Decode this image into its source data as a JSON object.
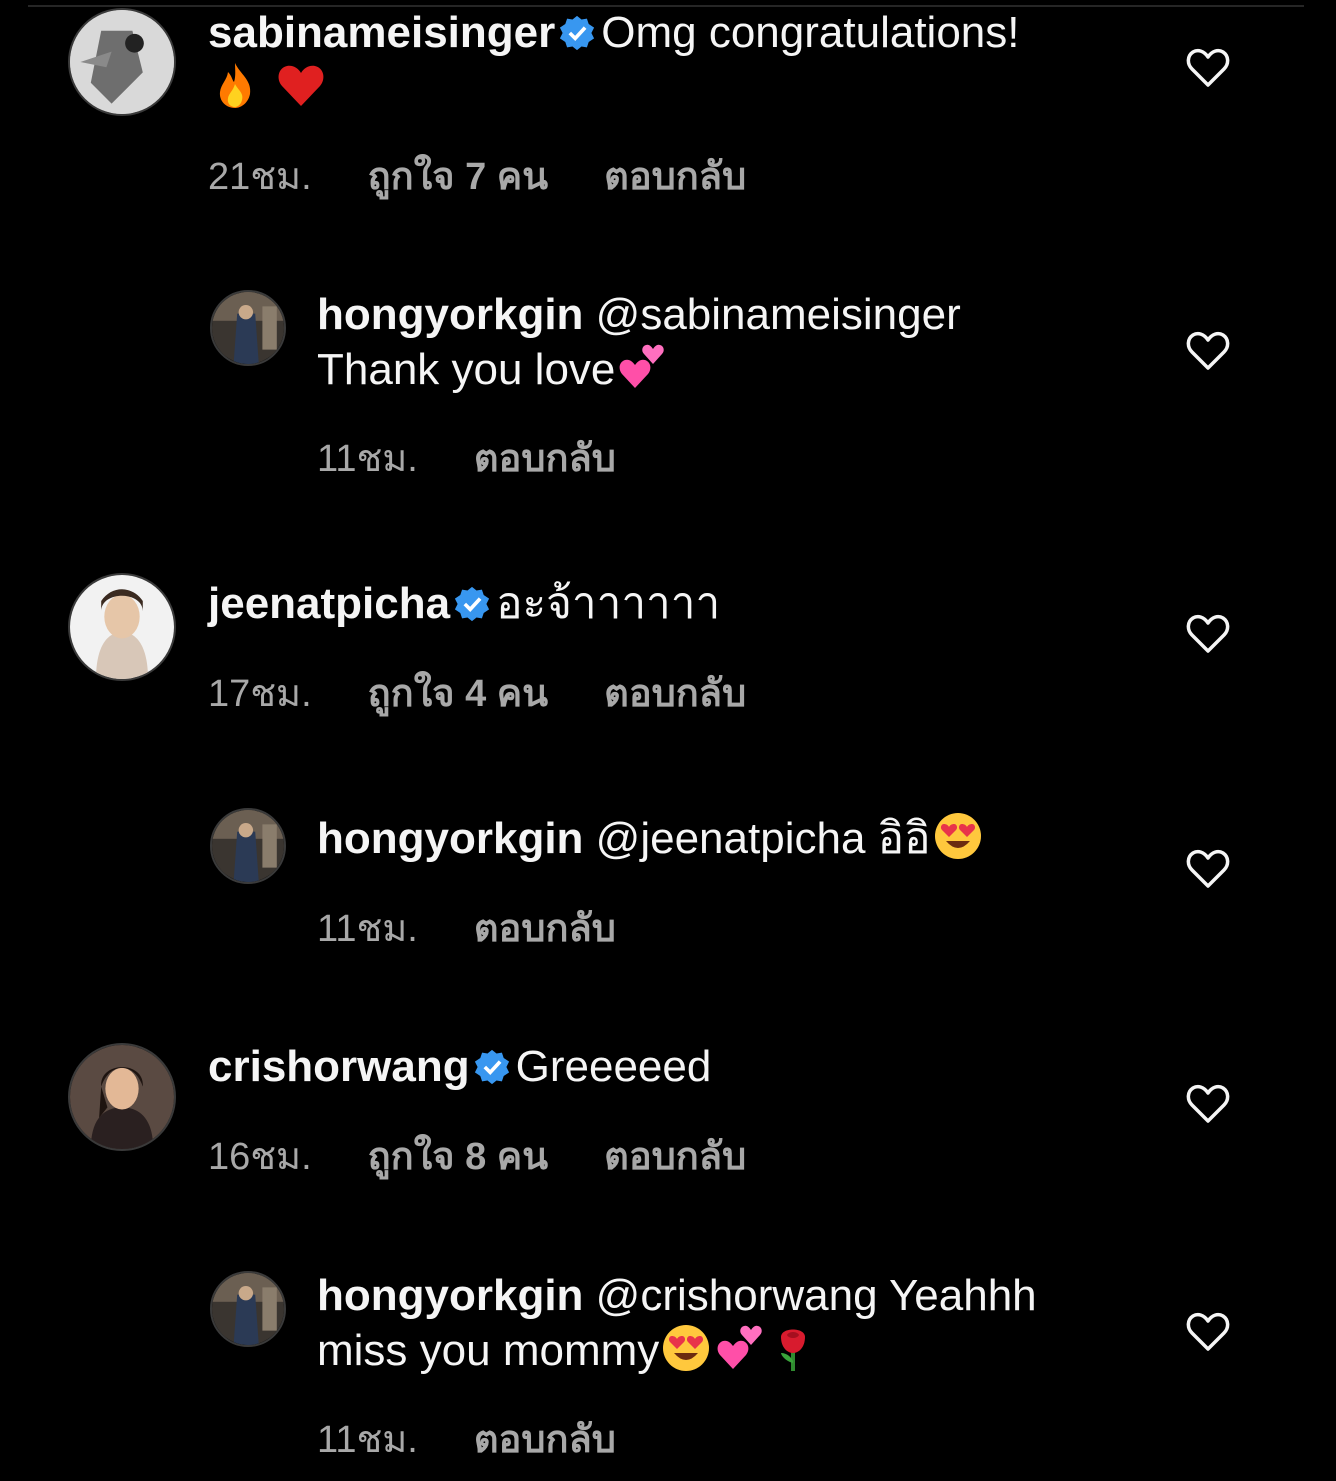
{
  "comments": [
    {
      "user": "sabinameisinger",
      "verified": true,
      "text": "Omg congratulations!",
      "emojis": [
        "fire",
        "red-heart"
      ],
      "time": "21ชม.",
      "likes": "ถูกใจ 7 คน",
      "reply_label": "ตอบกลับ"
    },
    {
      "user": "hongyorkgin",
      "mention": "@sabinameisinger",
      "text": "Thank you love",
      "emojis": [
        "two-hearts"
      ],
      "time": "11ชม.",
      "reply_label": "ตอบกลับ"
    },
    {
      "user": "jeenatpicha",
      "verified": true,
      "text": "อะจ้าาาาาา",
      "time": "17ชม.",
      "likes": "ถูกใจ 4 คน",
      "reply_label": "ตอบกลับ"
    },
    {
      "user": "hongyorkgin",
      "mention": "@jeenatpicha",
      "text": "อิอิ",
      "emojis": [
        "heart-eyes"
      ],
      "time": "11ชม.",
      "reply_label": "ตอบกลับ"
    },
    {
      "user": "crishorwang",
      "verified": true,
      "text": "Greeeeed",
      "time": "16ชม.",
      "likes": "ถูกใจ 8 คน",
      "reply_label": "ตอบกลับ"
    },
    {
      "user": "hongyorkgin",
      "mention": "@crishorwang",
      "text": "Yeahhh miss you mommy",
      "emojis": [
        "heart-eyes",
        "two-hearts",
        "rose"
      ],
      "time": "11ชม.",
      "reply_label": "ตอบกลับ"
    }
  ],
  "colors": {
    "background": "#000000",
    "text": "#f5f5f5",
    "secondary": "#a8a8a8",
    "verified": "#3897f0"
  }
}
